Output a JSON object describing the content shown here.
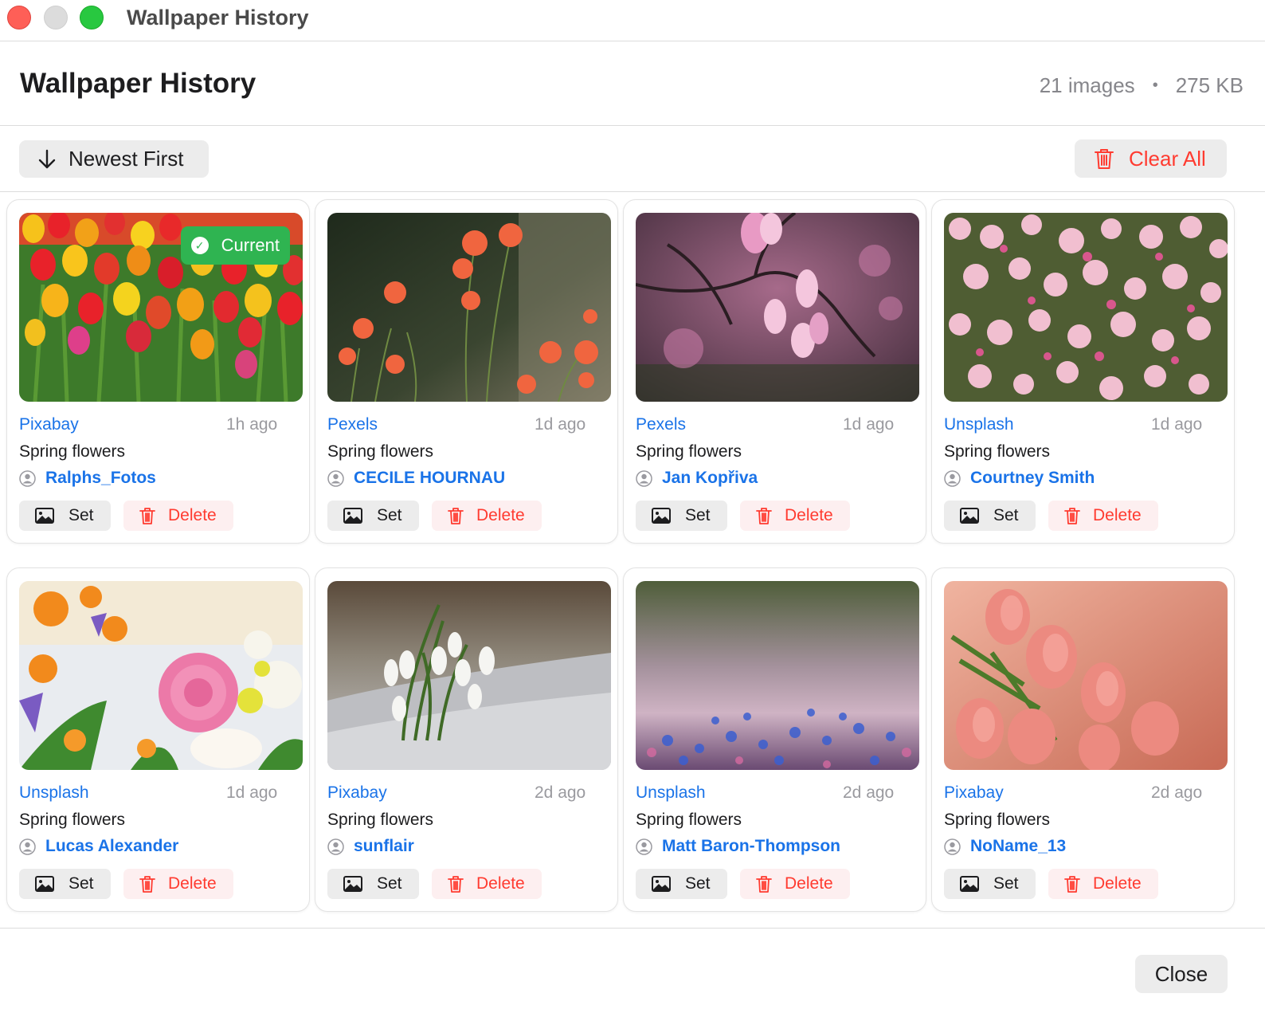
{
  "window": {
    "title": "Wallpaper History"
  },
  "header": {
    "title": "Wallpaper History",
    "image_count": "21 images",
    "separator": "•",
    "total_size": "275 KB"
  },
  "toolbar": {
    "sort_label": "Newest First",
    "sort_icon": "arrow-down-icon",
    "clear_label": "Clear All",
    "clear_icon": "trash-icon"
  },
  "badge": {
    "current_label": "Current"
  },
  "actions": {
    "set_label": "Set",
    "delete_label": "Delete"
  },
  "footer": {
    "close_label": "Close"
  },
  "colors": {
    "link": "#1a73e8",
    "danger": "#ff3b30",
    "current": "#2fb451"
  },
  "wallpapers": [
    {
      "source": "Pixabay",
      "time": "1h ago",
      "category": "Spring flowers",
      "author": "Ralphs_Fotos",
      "current": true,
      "image": "red and yellow tulip field"
    },
    {
      "source": "Pexels",
      "time": "1d ago",
      "category": "Spring flowers",
      "author": "CECILE HOURNAU",
      "current": false,
      "image": "orange poppies on dark background"
    },
    {
      "source": "Pexels",
      "time": "1d ago",
      "category": "Spring flowers",
      "author": "Jan Kopřiva",
      "current": false,
      "image": "pink magnolia blossoms"
    },
    {
      "source": "Unsplash",
      "time": "1d ago",
      "category": "Spring flowers",
      "author": "Courtney Smith",
      "current": false,
      "image": "pink cherry blossoms"
    },
    {
      "source": "Unsplash",
      "time": "1d ago",
      "category": "Spring flowers",
      "author": "Lucas Alexander",
      "current": false,
      "image": "colorful flower bouquet with rose"
    },
    {
      "source": "Pixabay",
      "time": "2d ago",
      "category": "Spring flowers",
      "author": "sunflair",
      "current": false,
      "image": "snowdrops in snow"
    },
    {
      "source": "Unsplash",
      "time": "2d ago",
      "category": "Spring flowers",
      "author": "Matt Baron-Thompson",
      "current": false,
      "image": "blue forget-me-nots meadow"
    },
    {
      "source": "Pixabay",
      "time": "2d ago",
      "category": "Spring flowers",
      "author": "NoName_13",
      "current": false,
      "image": "pink tulips bouquet"
    }
  ]
}
